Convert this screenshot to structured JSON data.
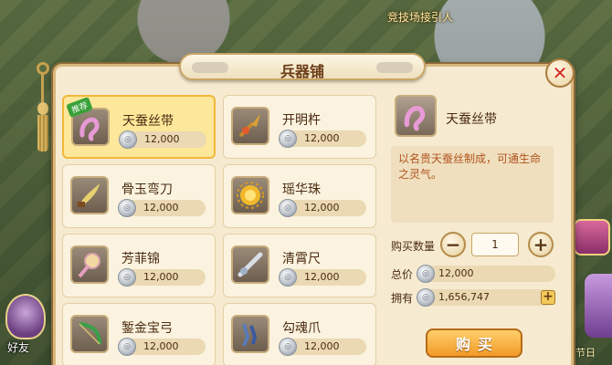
{
  "background": {
    "location_label": "竞技场接引人",
    "friend_label": "好友",
    "side_label": "节日"
  },
  "window": {
    "title": "兵器铺",
    "close_glyph": "✕"
  },
  "items": [
    {
      "name": "天蚕丝带",
      "price": "12,000",
      "badge": "推荐",
      "icon": "ribbon-icon",
      "selected": true
    },
    {
      "name": "开明杵",
      "price": "12,000",
      "icon": "pestle-icon"
    },
    {
      "name": "骨玉弯刀",
      "price": "12,000",
      "icon": "curved-blade-icon"
    },
    {
      "name": "瑶华珠",
      "price": "12,000",
      "icon": "orb-icon"
    },
    {
      "name": "芳菲锦",
      "price": "12,000",
      "icon": "flower-brocade-icon"
    },
    {
      "name": "清霄尺",
      "price": "12,000",
      "icon": "ruler-icon"
    },
    {
      "name": "錾金宝弓",
      "price": "12,000",
      "icon": "bow-icon"
    },
    {
      "name": "勾魂爪",
      "price": "12,000",
      "icon": "claw-icon"
    }
  ],
  "detail": {
    "name": "天蚕丝带",
    "description": "以名贵天蚕丝制成，可通生命之灵气。",
    "quantity_label": "购买数量",
    "quantity": "1",
    "minus_glyph": "−",
    "plus_glyph": "+",
    "total_label": "总价",
    "total_value": "12,000",
    "owned_label": "拥有",
    "owned_value": "1,656,747",
    "add_glyph": "+",
    "buy_label": "购买"
  },
  "colors": {
    "panel_bg": "#f6ead0",
    "selected_bg": "#fde79a",
    "buy_button": "#f19a28",
    "close_x": "#d22b22",
    "description_text": "#b2541c"
  }
}
